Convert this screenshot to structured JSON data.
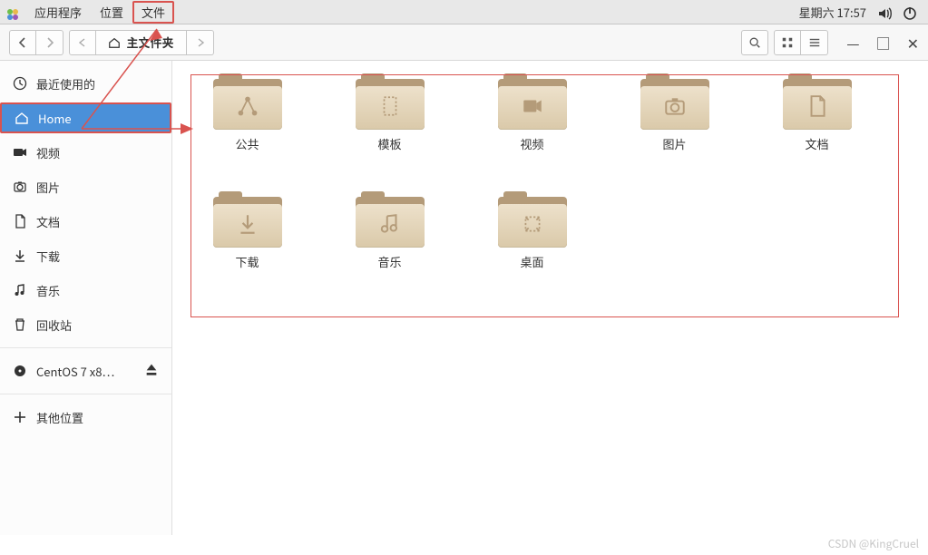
{
  "menubar": {
    "items": [
      "应用程序",
      "位置",
      "文件"
    ],
    "highlight_index": 2,
    "datetime": "星期六 17:57"
  },
  "toolbar": {
    "path_label": "主文件夹"
  },
  "sidebar": {
    "items": [
      {
        "label": "最近使用的",
        "icon": "clock"
      },
      {
        "label": "Home",
        "icon": "home",
        "active": true,
        "highlight": true
      },
      {
        "label": "视频",
        "icon": "video"
      },
      {
        "label": "图片",
        "icon": "camera"
      },
      {
        "label": "文档",
        "icon": "doc"
      },
      {
        "label": "下载",
        "icon": "download"
      },
      {
        "label": "音乐",
        "icon": "music"
      },
      {
        "label": "回收站",
        "icon": "trash"
      }
    ],
    "disk": {
      "label": "CentOS 7 x8…",
      "icon": "disc"
    },
    "other": {
      "label": "其他位置",
      "icon": "plus"
    }
  },
  "folders": [
    {
      "label": "公共",
      "glyph": "share"
    },
    {
      "label": "模板",
      "glyph": "template"
    },
    {
      "label": "视频",
      "glyph": "video"
    },
    {
      "label": "图片",
      "glyph": "camera"
    },
    {
      "label": "文档",
      "glyph": "doc"
    },
    {
      "label": "下载",
      "glyph": "download"
    },
    {
      "label": "音乐",
      "glyph": "music"
    },
    {
      "label": "桌面",
      "glyph": "desktop"
    }
  ],
  "watermark": "CSDN @KingCruel"
}
